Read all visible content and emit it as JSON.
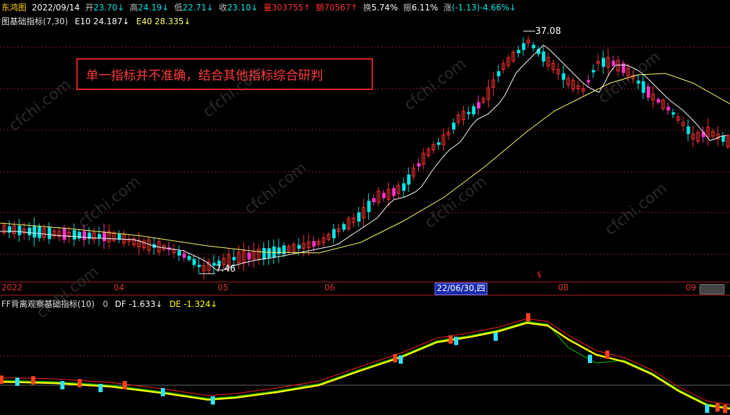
{
  "header": {
    "app_name": "东鸿图",
    "date": "2022/09/14",
    "open_label": "开",
    "open_value": "23.70↓",
    "high_label": "高",
    "high_value": "24.19↓",
    "low_label": "低",
    "low_value": "22.71↓",
    "close_label": "收",
    "close_value": "23.10↓",
    "volume_label": "量",
    "volume_value": "303755↑",
    "amount_label": "额",
    "amount_value": "70567↑",
    "turnover_label": "换",
    "turnover_value": "5.74%",
    "amplitude_label": "振",
    "amplitude_value": "6.11%",
    "change_label": "涨",
    "change_value": "(-1.13)-4.66%↓"
  },
  "main_indicator": {
    "name": "图基础指标(7,30)",
    "e10_label": "E10",
    "e10_value": "24.187↓",
    "e40_label": "E40",
    "e40_value": "28.335↓"
  },
  "annotation": {
    "text": "单一指标并不准确，结合其他指标综合研判"
  },
  "price_labels": {
    "max": "37.08",
    "min": "7.46",
    "marker": "§"
  },
  "x_axis": {
    "labels": [
      "2022",
      "04",
      "05",
      "06",
      "08",
      "09"
    ],
    "cursor_label": "22/06/30,四"
  },
  "sub_indicator": {
    "name": "FF背离观察基础指标(10)",
    "zero": "0",
    "df_label": "DF",
    "df_value": "-1.633↓",
    "de_label": "DE",
    "de_value": "-1.324↓"
  },
  "watermark": "cfchi.com",
  "colors": {
    "background": "#000000",
    "bull": "#ff3232",
    "bear": "#00e5e5",
    "ma_short": "#ffffff",
    "ma_long": "#ffff66",
    "grid": "#8b1a1a",
    "df_line": "#00cc00",
    "de_line": "#ffff00"
  }
}
